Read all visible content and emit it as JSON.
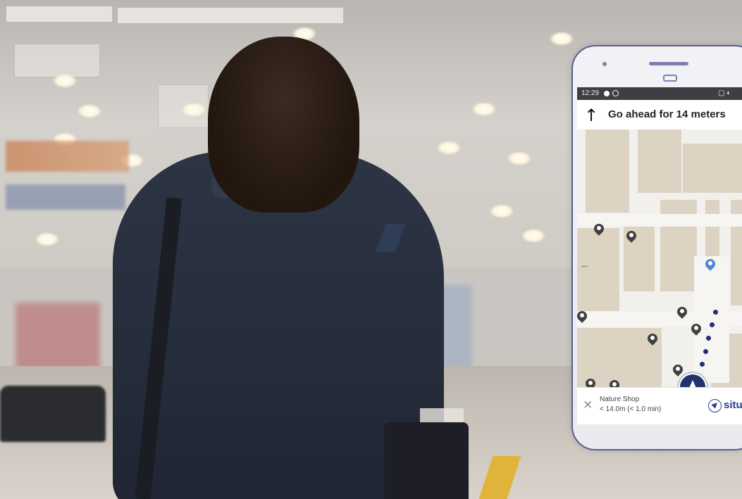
{
  "navigation": {
    "status_time": "12:29",
    "instruction": "Go ahead for 14 meters",
    "destination_name": "Nature Shop",
    "destination_eta": "< 14.0m (< 1.0 min)",
    "brand_text": "situ"
  },
  "icons": {
    "direction": "arrow-up-icon",
    "close": "close-icon",
    "location": "current-location-icon",
    "poi": "map-pin-icon",
    "brand": "navigation-icon"
  },
  "colors": {
    "route": "#1f2f7a",
    "location_marker": "#23336b",
    "phone_frame": "#5a5e93",
    "map_block": "#ddd3c3"
  }
}
